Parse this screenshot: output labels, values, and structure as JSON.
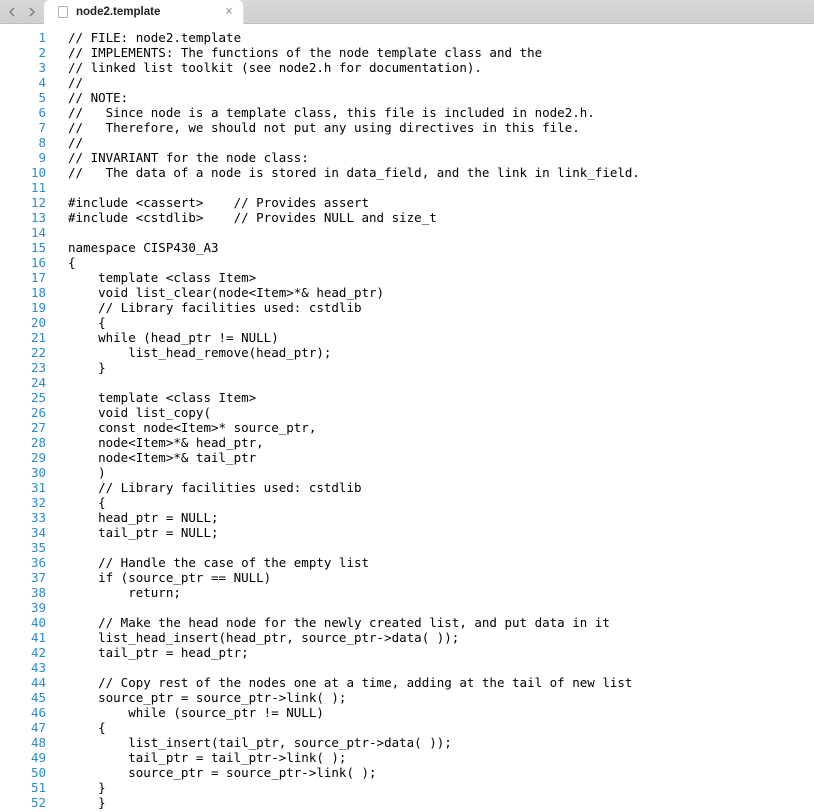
{
  "tab": {
    "label": "node2.template",
    "close_glyph": "×"
  },
  "code_lines": [
    "// FILE: node2.template",
    "// IMPLEMENTS: The functions of the node template class and the",
    "// linked list toolkit (see node2.h for documentation).",
    "//",
    "// NOTE:",
    "//   Since node is a template class, this file is included in node2.h.",
    "//   Therefore, we should not put any using directives in this file.",
    "//",
    "// INVARIANT for the node class:",
    "//   The data of a node is stored in data_field, and the link in link_field.",
    "",
    "#include <cassert>    // Provides assert",
    "#include <cstdlib>    // Provides NULL and size_t",
    "",
    "namespace CISP430_A3",
    "{",
    "    template <class Item>",
    "    void list_clear(node<Item>*& head_ptr)",
    "    // Library facilities used: cstdlib",
    "    {",
    "    while (head_ptr != NULL)",
    "        list_head_remove(head_ptr);",
    "    }",
    "",
    "    template <class Item>",
    "    void list_copy(",
    "    const node<Item>* source_ptr,",
    "    node<Item>*& head_ptr,",
    "    node<Item>*& tail_ptr",
    "    )",
    "    // Library facilities used: cstdlib",
    "    {",
    "    head_ptr = NULL;",
    "    tail_ptr = NULL;",
    "",
    "    // Handle the case of the empty list",
    "    if (source_ptr == NULL)",
    "        return;",
    "",
    "    // Make the head node for the newly created list, and put data in it",
    "    list_head_insert(head_ptr, source_ptr->data( ));",
    "    tail_ptr = head_ptr;",
    "",
    "    // Copy rest of the nodes one at a time, adding at the tail of new list",
    "    source_ptr = source_ptr->link( );",
    "        while (source_ptr != NULL)",
    "    {",
    "        list_insert(tail_ptr, source_ptr->data( ));",
    "        tail_ptr = tail_ptr->link( );",
    "        source_ptr = source_ptr->link( );",
    "    }",
    "    }"
  ]
}
